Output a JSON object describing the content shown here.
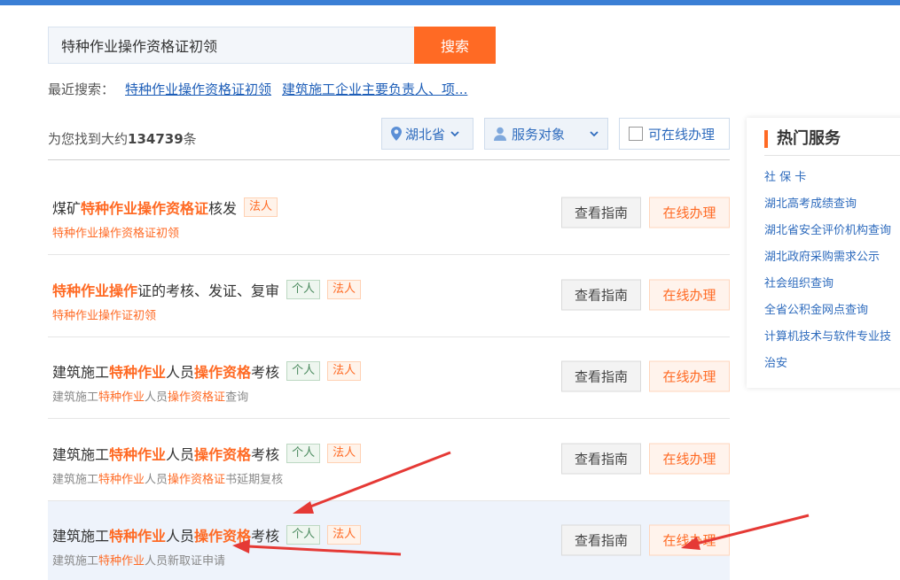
{
  "search": {
    "value": "特种作业操作资格证初领",
    "button": "搜索"
  },
  "recent": {
    "label": "最近搜索：",
    "links": [
      "特种作业操作资格证初领",
      "建筑施工企业主要负责人、项..."
    ]
  },
  "result_count": {
    "prefix": "为您找到大约",
    "count": "134739",
    "suffix": "条"
  },
  "filters": {
    "region": "湖北省",
    "target": "服务对象",
    "online": "可在线办理"
  },
  "results": [
    {
      "title": [
        {
          "t": "煤矿",
          "h": false
        },
        {
          "t": "特种作业操作资格证",
          "h": true
        },
        {
          "t": "核发",
          "h": false
        }
      ],
      "tags": [
        "法人"
      ],
      "sub": [
        {
          "t": "特种作业操作资格证初领",
          "h": true
        }
      ],
      "sub_orange": true
    },
    {
      "title": [
        {
          "t": "特种作业操作",
          "h": true
        },
        {
          "t": "证的考核、发证、复审",
          "h": false
        }
      ],
      "tags": [
        "个人",
        "法人"
      ],
      "sub": [
        {
          "t": "特种作业操作证初领",
          "h": true
        }
      ],
      "sub_orange": true
    },
    {
      "title": [
        {
          "t": "建筑施工",
          "h": false
        },
        {
          "t": "特种作业",
          "h": true
        },
        {
          "t": "人员",
          "h": false
        },
        {
          "t": "操作资格",
          "h": true
        },
        {
          "t": "考核",
          "h": false
        }
      ],
      "tags": [
        "个人",
        "法人"
      ],
      "sub": [
        {
          "t": "建筑施工",
          "h": false
        },
        {
          "t": "特种作业",
          "h": true
        },
        {
          "t": "人员",
          "h": false
        },
        {
          "t": "操作资格证",
          "h": true
        },
        {
          "t": "查询",
          "h": false
        }
      ],
      "sub_orange": false
    },
    {
      "title": [
        {
          "t": "建筑施工",
          "h": false
        },
        {
          "t": "特种作业",
          "h": true
        },
        {
          "t": "人员",
          "h": false
        },
        {
          "t": "操作资格",
          "h": true
        },
        {
          "t": "考核",
          "h": false
        }
      ],
      "tags": [
        "个人",
        "法人"
      ],
      "sub": [
        {
          "t": "建筑施工",
          "h": false
        },
        {
          "t": "特种作业",
          "h": true
        },
        {
          "t": "人员",
          "h": false
        },
        {
          "t": "操作资格证",
          "h": true
        },
        {
          "t": "书延期复核",
          "h": false
        }
      ],
      "sub_orange": false
    },
    {
      "title": [
        {
          "t": "建筑施工",
          "h": false
        },
        {
          "t": "特种作业",
          "h": true
        },
        {
          "t": "人员",
          "h": false
        },
        {
          "t": "操作资格",
          "h": true
        },
        {
          "t": "考核",
          "h": false
        }
      ],
      "tags": [
        "个人",
        "法人"
      ],
      "sub": [
        {
          "t": "建筑施工",
          "h": false
        },
        {
          "t": "特种作业",
          "h": true
        },
        {
          "t": "人员新取证申请",
          "h": false
        }
      ],
      "sub_orange": false
    }
  ],
  "row_buttons": {
    "guide": "查看指南",
    "online": "在线办理"
  },
  "hot": {
    "title": "热门服务",
    "items": [
      "社 保 卡",
      "湖北高考成绩查询",
      "湖北省安全评价机构查询",
      "湖北政府采购需求公示",
      "社会组织查询",
      "全省公积金网点查询",
      "计算机技术与软件专业技",
      "治安"
    ]
  },
  "colors": {
    "accent": "#ff6a24",
    "link": "#1f5fb8",
    "topbar": "#3a7fd5",
    "annotation": "#e53935"
  }
}
